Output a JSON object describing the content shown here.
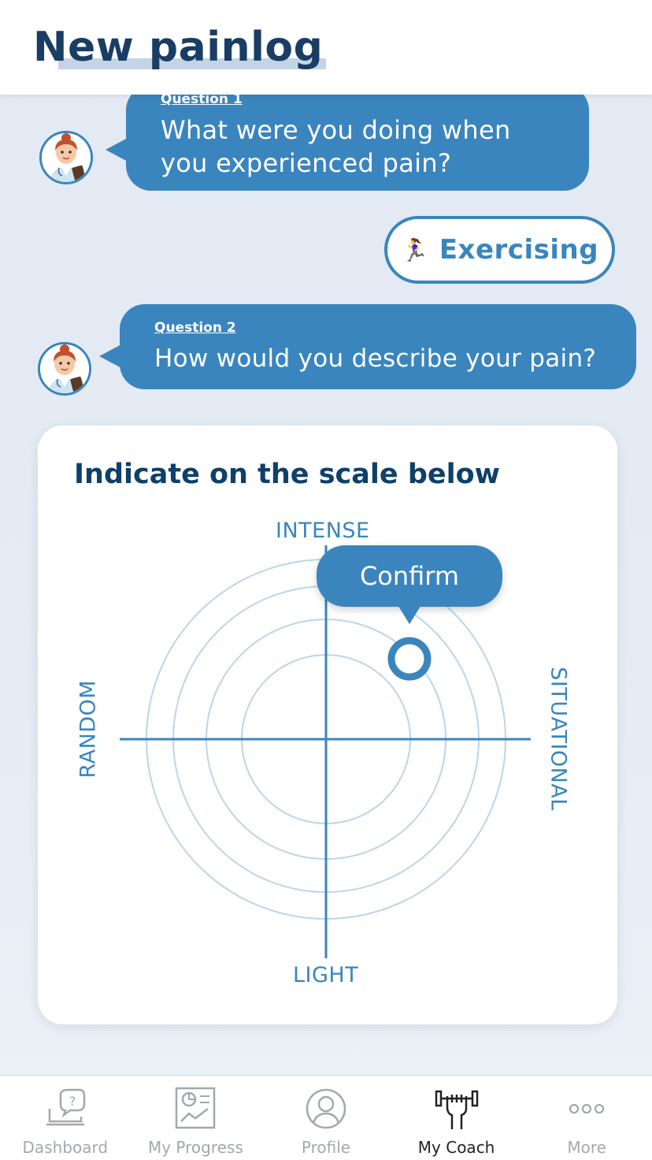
{
  "header": {
    "title": "New painlog"
  },
  "chat": {
    "question1": {
      "label": "Question 1",
      "text_line1": "What were you doing when",
      "text_line2": "you experienced pain?"
    },
    "answer1": {
      "emoji": "🏃‍♀️",
      "text": "Exercising"
    },
    "question2": {
      "label": "Question 2",
      "text": "How would you describe your pain?"
    }
  },
  "scale_card": {
    "title": "Indicate on the scale below",
    "labels": {
      "top": "INTENSE",
      "bottom": "LIGHT",
      "left": "RANDOM",
      "right": "SITUATIONAL"
    },
    "confirm_label": "Confirm",
    "ring_count": 4
  },
  "nav": {
    "items": [
      {
        "label": "Dashboard",
        "icon": "dashboard-help-icon",
        "active": false
      },
      {
        "label": "My Progress",
        "icon": "progress-chart-icon",
        "active": false
      },
      {
        "label": "Profile",
        "icon": "profile-icon",
        "active": false
      },
      {
        "label": "My Coach",
        "icon": "dumbbell-hand-icon",
        "active": true
      },
      {
        "label": "More",
        "icon": "more-dots-icon",
        "active": false
      }
    ]
  },
  "colors": {
    "primary": "#3a85be",
    "title": "#1a3d63",
    "ring": "#bcd5ea",
    "nav_inactive": "#a3a8ad",
    "nav_active": "#222222"
  }
}
